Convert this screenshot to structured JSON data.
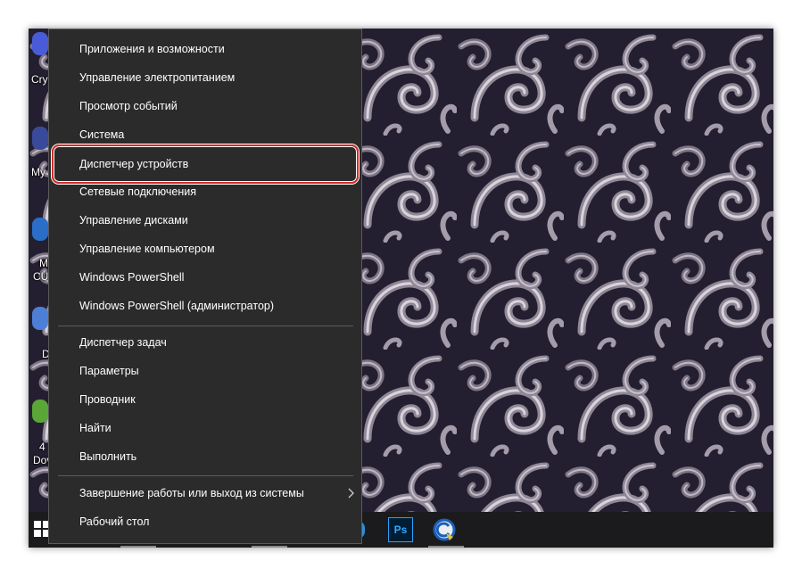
{
  "desktop": {
    "labels": [
      "Cry",
      "My",
      "M",
      "CU",
      "D",
      "4",
      "Dov"
    ]
  },
  "menu": {
    "group1": [
      {
        "label": "Приложения и возможности"
      },
      {
        "label": "Управление электропитанием"
      },
      {
        "label": "Просмотр событий"
      },
      {
        "label": "Система"
      },
      {
        "label": "Диспетчер устройств"
      },
      {
        "label": "Сетевые подключения"
      },
      {
        "label": "Управление дисками"
      },
      {
        "label": "Управление компьютером"
      },
      {
        "label": "Windows PowerShell"
      },
      {
        "label": "Windows PowerShell (администратор)"
      }
    ],
    "group2": [
      {
        "label": "Диспетчер задач"
      },
      {
        "label": "Параметры"
      },
      {
        "label": "Проводник"
      },
      {
        "label": "Найти"
      },
      {
        "label": "Выполнить"
      }
    ],
    "group3": [
      {
        "label": "Завершение работы или выход из системы",
        "submenu": true
      },
      {
        "label": "Рабочий стол"
      }
    ],
    "highlighted": "Диспетчер устройств"
  },
  "taskbar": {
    "apps": [
      {
        "name": "photoshop",
        "label": "Ps"
      },
      {
        "name": "ccleaner-icon"
      }
    ]
  },
  "colors": {
    "menu_bg": "#2b2b2b",
    "highlight": "#d42a2a",
    "taskbar_bg": "#1b1b1d"
  }
}
